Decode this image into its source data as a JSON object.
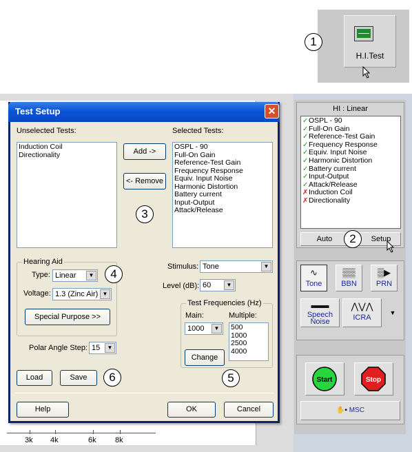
{
  "toolbar": {
    "hitest_label": "H.I.Test"
  },
  "callouts": [
    "1",
    "2",
    "3",
    "4",
    "5",
    "6"
  ],
  "axis": {
    "ticks": [
      "3k",
      "4k",
      "6k",
      "8k"
    ]
  },
  "hi_panel": {
    "title": "HI : Linear",
    "items": [
      {
        "label": "OSPL - 90",
        "status": "check"
      },
      {
        "label": "Full-On Gain",
        "status": "check"
      },
      {
        "label": "Reference-Test Gain",
        "status": "check"
      },
      {
        "label": "Frequency Response",
        "status": "check"
      },
      {
        "label": "Equiv. Input Noise",
        "status": "check"
      },
      {
        "label": "Harmonic Distortion",
        "status": "check"
      },
      {
        "label": "Battery current",
        "status": "check"
      },
      {
        "label": "Input-Output",
        "status": "check"
      },
      {
        "label": "Attack/Release",
        "status": "check"
      },
      {
        "label": "Induction Coil",
        "status": "cross"
      },
      {
        "label": "Directionality",
        "status": "cross"
      }
    ],
    "auto_label": "Auto",
    "setup_label": "Setup"
  },
  "stimulus_buttons": {
    "tone": "Tone",
    "bbn": "BBN",
    "prn": "PRN",
    "speech_noise_1": "Speech",
    "speech_noise_2": "Noise",
    "icra": "ICRA"
  },
  "run": {
    "start": "Start",
    "stop": "Stop",
    "msc": "MSC"
  },
  "dialog": {
    "title": "Test Setup",
    "unselected_label": "Unselected Tests:",
    "unselected": [
      "Induction Coil",
      "Directionality"
    ],
    "selected_label": "Selected Tests:",
    "selected": [
      "OSPL - 90",
      "Full-On Gain",
      "Reference-Test Gain",
      "Frequency Response",
      "Equiv. Input Noise",
      "Harmonic Distortion",
      "Battery current",
      "Input-Output",
      "Attack/Release"
    ],
    "add_label": "Add ->",
    "remove_label": "<- Remove",
    "hearing_aid_group": "Hearing Aid",
    "type_label": "Type:",
    "type_value": "Linear",
    "voltage_label": "Voltage:",
    "voltage_value": "1.3 (Zinc Air)",
    "special_purpose": "Special Purpose >>",
    "polar_label": "Polar Angle Step:",
    "polar_value": "15",
    "stimulus_label": "Stimulus:",
    "stimulus_value": "Tone",
    "level_label": "Level (dB):",
    "level_value": "60",
    "freq_group": "Test Frequencies (Hz)",
    "main_label": "Main:",
    "main_value": "1000",
    "multiple_label": "Multiple:",
    "multiple": [
      "500",
      "1000",
      "2500",
      "4000"
    ],
    "change_label": "Change",
    "load_label": "Load",
    "save_label": "Save",
    "help_label": "Help",
    "ok_label": "OK",
    "cancel_label": "Cancel"
  }
}
